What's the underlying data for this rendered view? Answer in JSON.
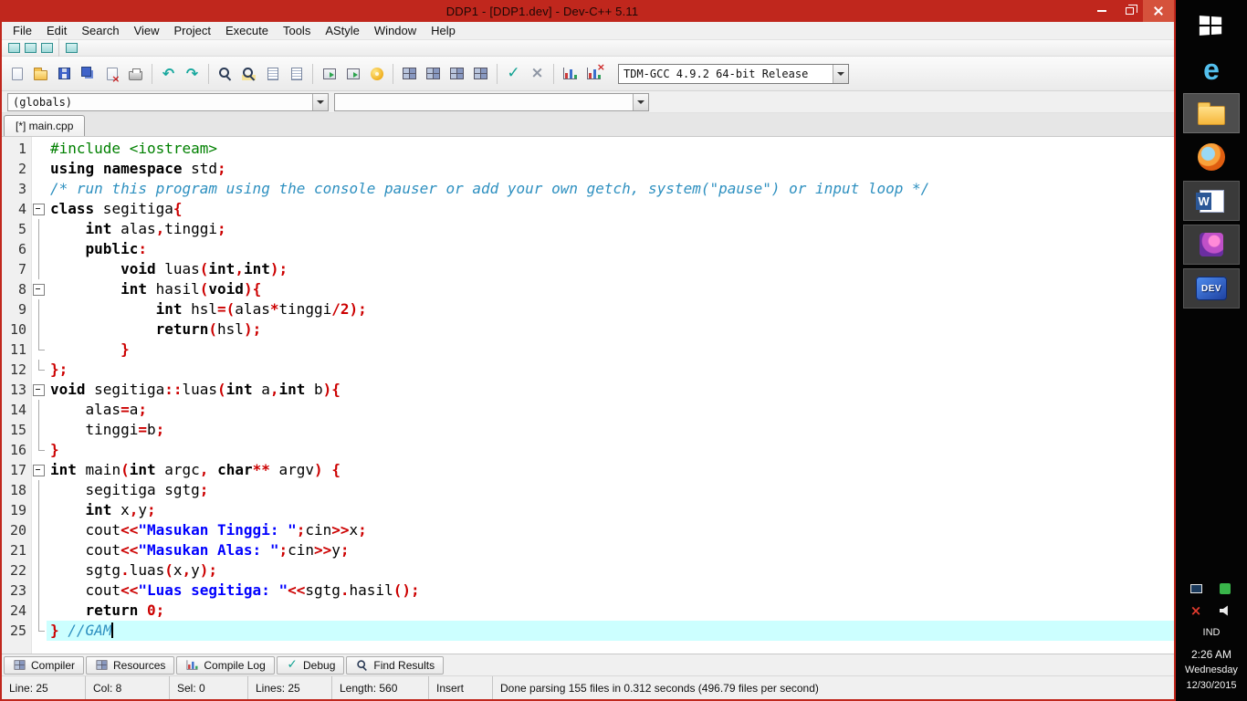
{
  "colors": {
    "titlebar": "#C0271D",
    "taskbar": "#040404",
    "current_line_bg": "#CCFFFF",
    "keyword": "#000000",
    "string": "#0000FF",
    "comment": "#2E90C0",
    "symbol": "#CC0000",
    "preprocessor": "#008000"
  },
  "window": {
    "title": "DDP1 - [DDP1.dev] - Dev-C++ 5.11"
  },
  "menu": {
    "items": [
      "File",
      "Edit",
      "Search",
      "View",
      "Project",
      "Execute",
      "Tools",
      "AStyle",
      "Window",
      "Help"
    ]
  },
  "toolbar_small": [
    {
      "name": "insert-button",
      "glyph": "win-teal"
    },
    {
      "name": "toggle-bookmark-button",
      "glyph": "win-teal"
    },
    {
      "name": "goto-bookmark-button",
      "glyph": "win-teal"
    },
    "|",
    {
      "name": "astyle-format-button",
      "glyph": "win-teal"
    }
  ],
  "toolbar_main": [
    {
      "name": "new-source-button",
      "glyph": "page"
    },
    {
      "name": "open-button",
      "glyph": "folder"
    },
    {
      "name": "save-button",
      "glyph": "floppy"
    },
    {
      "name": "save-all-button",
      "glyph": "floppy2"
    },
    {
      "name": "close-file-button",
      "glyph": "page-x"
    },
    {
      "name": "print-button",
      "glyph": "printer"
    },
    "|",
    {
      "name": "undo-button",
      "glyph": "undo"
    },
    {
      "name": "redo-button",
      "glyph": "redo"
    },
    "|",
    {
      "name": "find-button",
      "glyph": "mag"
    },
    {
      "name": "replace-button",
      "glyph": "mag2"
    },
    {
      "name": "find-next-button",
      "glyph": "lines"
    },
    {
      "name": "goto-line-button",
      "glyph": "lines"
    },
    "|",
    {
      "name": "add-to-project-button",
      "glyph": "win-green"
    },
    {
      "name": "remove-from-project-button",
      "glyph": "win-green"
    },
    {
      "name": "insert-snippet-button",
      "glyph": "donut"
    },
    "|",
    {
      "name": "compile-button",
      "glyph": "grid"
    },
    {
      "name": "run-button",
      "glyph": "grid"
    },
    {
      "name": "compile-run-button",
      "glyph": "grid"
    },
    {
      "name": "rebuild-button",
      "glyph": "grid"
    },
    "|",
    {
      "name": "syntax-check-button",
      "glyph": "check"
    },
    {
      "name": "abort-button",
      "glyph": "cross"
    },
    "|",
    {
      "name": "profile-button",
      "glyph": "chart"
    },
    {
      "name": "delete-profiling-button",
      "glyph": "chart-x"
    }
  ],
  "compiler_combo": {
    "value": "TDM-GCC 4.9.2 64-bit Release"
  },
  "class_browser": {
    "left": "(globals)",
    "right": ""
  },
  "editor_tabs": [
    {
      "label": "[*] main.cpp"
    }
  ],
  "editor": {
    "current_line": 25,
    "caret_col": 8,
    "lines": [
      {
        "num": 1,
        "fold": null,
        "tokens": [
          [
            "pre",
            "#include <iostream>"
          ]
        ]
      },
      {
        "num": 2,
        "fold": null,
        "tokens": [
          [
            "kw",
            "using"
          ],
          [
            "pl",
            " "
          ],
          [
            "kw",
            "namespace"
          ],
          [
            "pl",
            " std"
          ],
          [
            "sym",
            ";"
          ]
        ]
      },
      {
        "num": 3,
        "fold": null,
        "tokens": [
          [
            "com",
            "/* run this program using the console pauser or add your own getch, system(\"pause\") or input loop */"
          ]
        ]
      },
      {
        "num": 4,
        "fold": "open",
        "tokens": [
          [
            "kw",
            "class"
          ],
          [
            "pl",
            " segitiga"
          ],
          [
            "sym",
            "{"
          ]
        ]
      },
      {
        "num": 5,
        "fold": "line",
        "tokens": [
          [
            "pl",
            "    "
          ],
          [
            "kw",
            "int"
          ],
          [
            "pl",
            " alas"
          ],
          [
            "sym",
            ","
          ],
          [
            "pl",
            "tinggi"
          ],
          [
            "sym",
            ";"
          ]
        ]
      },
      {
        "num": 6,
        "fold": "line",
        "tokens": [
          [
            "pl",
            "    "
          ],
          [
            "kw",
            "public"
          ],
          [
            "sym",
            ":"
          ]
        ]
      },
      {
        "num": 7,
        "fold": "line",
        "tokens": [
          [
            "pl",
            "        "
          ],
          [
            "kw",
            "void"
          ],
          [
            "pl",
            " luas"
          ],
          [
            "sym",
            "("
          ],
          [
            "kw",
            "int"
          ],
          [
            "sym",
            ","
          ],
          [
            "kw",
            "int"
          ],
          [
            "sym",
            ");"
          ]
        ]
      },
      {
        "num": 8,
        "fold": "open",
        "tokens": [
          [
            "pl",
            "        "
          ],
          [
            "kw",
            "int"
          ],
          [
            "pl",
            " hasil"
          ],
          [
            "sym",
            "("
          ],
          [
            "kw",
            "void"
          ],
          [
            "sym",
            "){"
          ]
        ]
      },
      {
        "num": 9,
        "fold": "line",
        "tokens": [
          [
            "pl",
            "            "
          ],
          [
            "kw",
            "int"
          ],
          [
            "pl",
            " hsl"
          ],
          [
            "sym",
            "=("
          ],
          [
            "pl",
            "alas"
          ],
          [
            "sym",
            "*"
          ],
          [
            "pl",
            "tinggi"
          ],
          [
            "sym",
            "/"
          ],
          [
            "num",
            "2"
          ],
          [
            "sym",
            ");"
          ]
        ]
      },
      {
        "num": 10,
        "fold": "line",
        "tokens": [
          [
            "pl",
            "            "
          ],
          [
            "kw",
            "return"
          ],
          [
            "sym",
            "("
          ],
          [
            "pl",
            "hsl"
          ],
          [
            "sym",
            ");"
          ]
        ]
      },
      {
        "num": 11,
        "fold": "end",
        "tokens": [
          [
            "pl",
            "        "
          ],
          [
            "sym",
            "}"
          ]
        ]
      },
      {
        "num": 12,
        "fold": "end",
        "tokens": [
          [
            "sym",
            "};"
          ]
        ]
      },
      {
        "num": 13,
        "fold": "open",
        "tokens": [
          [
            "kw",
            "void"
          ],
          [
            "pl",
            " segitiga"
          ],
          [
            "sym",
            "::"
          ],
          [
            "pl",
            "luas"
          ],
          [
            "sym",
            "("
          ],
          [
            "kw",
            "int"
          ],
          [
            "pl",
            " a"
          ],
          [
            "sym",
            ","
          ],
          [
            "kw",
            "int"
          ],
          [
            "pl",
            " b"
          ],
          [
            "sym",
            "){"
          ]
        ]
      },
      {
        "num": 14,
        "fold": "line",
        "tokens": [
          [
            "pl",
            "    alas"
          ],
          [
            "sym",
            "="
          ],
          [
            "pl",
            "a"
          ],
          [
            "sym",
            ";"
          ]
        ]
      },
      {
        "num": 15,
        "fold": "line",
        "tokens": [
          [
            "pl",
            "    tinggi"
          ],
          [
            "sym",
            "="
          ],
          [
            "pl",
            "b"
          ],
          [
            "sym",
            ";"
          ]
        ]
      },
      {
        "num": 16,
        "fold": "end",
        "tokens": [
          [
            "sym",
            "}"
          ]
        ]
      },
      {
        "num": 17,
        "fold": "open",
        "tokens": [
          [
            "kw",
            "int"
          ],
          [
            "pl",
            " main"
          ],
          [
            "sym",
            "("
          ],
          [
            "kw",
            "int"
          ],
          [
            "pl",
            " argc"
          ],
          [
            "sym",
            ","
          ],
          [
            "pl",
            " "
          ],
          [
            "kw",
            "char"
          ],
          [
            "sym",
            "**"
          ],
          [
            "pl",
            " argv"
          ],
          [
            "sym",
            ")"
          ],
          [
            "pl",
            " "
          ],
          [
            "sym",
            "{"
          ]
        ]
      },
      {
        "num": 18,
        "fold": "line",
        "tokens": [
          [
            "pl",
            "    segitiga sgtg"
          ],
          [
            "sym",
            ";"
          ]
        ]
      },
      {
        "num": 19,
        "fold": "line",
        "tokens": [
          [
            "pl",
            "    "
          ],
          [
            "kw",
            "int"
          ],
          [
            "pl",
            " x"
          ],
          [
            "sym",
            ","
          ],
          [
            "pl",
            "y"
          ],
          [
            "sym",
            ";"
          ]
        ]
      },
      {
        "num": 20,
        "fold": "line",
        "tokens": [
          [
            "pl",
            "    cout"
          ],
          [
            "sym",
            "<<"
          ],
          [
            "str",
            "\"Masukan Tinggi: \""
          ],
          [
            "sym",
            ";"
          ],
          [
            "pl",
            "cin"
          ],
          [
            "sym",
            ">>"
          ],
          [
            "pl",
            "x"
          ],
          [
            "sym",
            ";"
          ]
        ]
      },
      {
        "num": 21,
        "fold": "line",
        "tokens": [
          [
            "pl",
            "    cout"
          ],
          [
            "sym",
            "<<"
          ],
          [
            "str",
            "\"Masukan Alas: \""
          ],
          [
            "sym",
            ";"
          ],
          [
            "pl",
            "cin"
          ],
          [
            "sym",
            ">>"
          ],
          [
            "pl",
            "y"
          ],
          [
            "sym",
            ";"
          ]
        ]
      },
      {
        "num": 22,
        "fold": "line",
        "tokens": [
          [
            "pl",
            "    sgtg"
          ],
          [
            "sym",
            "."
          ],
          [
            "pl",
            "luas"
          ],
          [
            "sym",
            "("
          ],
          [
            "pl",
            "x"
          ],
          [
            "sym",
            ","
          ],
          [
            "pl",
            "y"
          ],
          [
            "sym",
            ");"
          ]
        ]
      },
      {
        "num": 23,
        "fold": "line",
        "tokens": [
          [
            "pl",
            "    cout"
          ],
          [
            "sym",
            "<<"
          ],
          [
            "str",
            "\"Luas segitiga: \""
          ],
          [
            "sym",
            "<<"
          ],
          [
            "pl",
            "sgtg"
          ],
          [
            "sym",
            "."
          ],
          [
            "pl",
            "hasil"
          ],
          [
            "sym",
            "();"
          ]
        ]
      },
      {
        "num": 24,
        "fold": "line",
        "tokens": [
          [
            "pl",
            "    "
          ],
          [
            "kw",
            "return"
          ],
          [
            "pl",
            " "
          ],
          [
            "num",
            "0"
          ],
          [
            "sym",
            ";"
          ]
        ]
      },
      {
        "num": 25,
        "fold": "end",
        "tokens": [
          [
            "sym",
            "}"
          ],
          [
            "pl",
            " "
          ],
          [
            "com",
            "//GAM"
          ],
          [
            "caret",
            ""
          ]
        ]
      }
    ]
  },
  "bottom_tabs": [
    {
      "name": "tab-compiler",
      "label": "Compiler",
      "glyph": "grid"
    },
    {
      "name": "tab-resources",
      "label": "Resources",
      "glyph": "grid"
    },
    {
      "name": "tab-compile-log",
      "label": "Compile Log",
      "glyph": "chart"
    },
    {
      "name": "tab-debug",
      "label": "Debug",
      "glyph": "check"
    },
    {
      "name": "tab-find-results",
      "label": "Find Results",
      "glyph": "mag"
    }
  ],
  "status_bar": {
    "cells": [
      "Line: 25",
      "Col: 8",
      "Sel: 0",
      "Lines: 25",
      "Length: 560",
      "Insert",
      "Done parsing 155 files in 0.312 seconds (496.79 files per second)"
    ]
  },
  "taskbar": {
    "apps": [
      {
        "name": "start-button",
        "kind": "windows"
      },
      {
        "name": "internet-explorer-button",
        "kind": "ie"
      },
      {
        "name": "file-explorer-button",
        "kind": "folder",
        "running": true,
        "active": true
      },
      {
        "name": "firefox-button",
        "kind": "firefox"
      },
      {
        "name": "word-button",
        "kind": "word",
        "running": true
      },
      {
        "name": "photos-app-button",
        "kind": "photos",
        "running": true
      },
      {
        "name": "devcpp-button",
        "kind": "dev",
        "running": true
      }
    ],
    "tray": {
      "language": "IND",
      "time": "2:26 AM",
      "weekday": "Wednesday",
      "date": "12/30/2015"
    }
  }
}
